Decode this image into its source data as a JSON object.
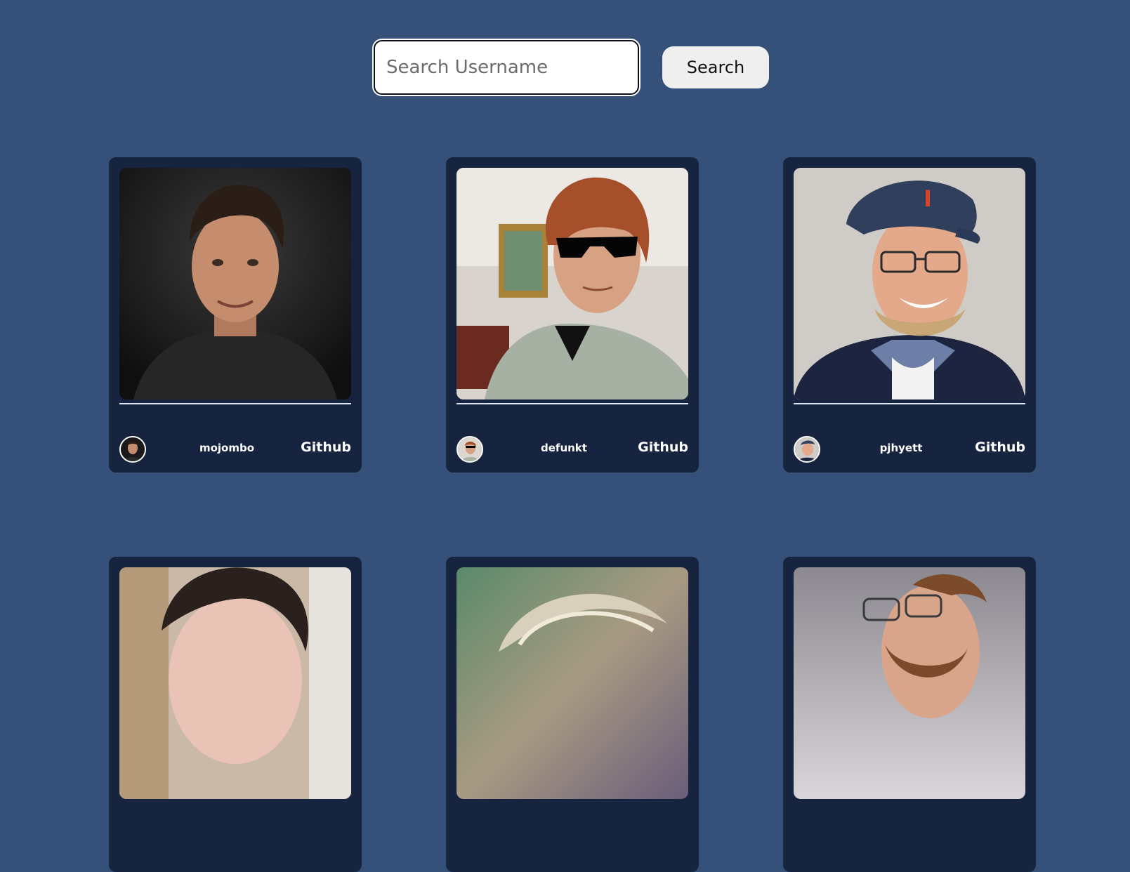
{
  "search": {
    "placeholder": "Search Username",
    "button_label": "Search"
  },
  "colors": {
    "page_background": "#355079",
    "card_background": "#162440"
  },
  "users": [
    {
      "username": "mojombo",
      "link_label": "Github",
      "icon": "avatar-photo"
    },
    {
      "username": "defunkt",
      "link_label": "Github",
      "icon": "avatar-photo"
    },
    {
      "username": "pjhyett",
      "link_label": "Github",
      "icon": "avatar-photo"
    },
    {
      "username": "",
      "link_label": "",
      "icon": "avatar-photo"
    },
    {
      "username": "",
      "link_label": "",
      "icon": "avatar-photo"
    },
    {
      "username": "",
      "link_label": "",
      "icon": "avatar-photo"
    }
  ]
}
